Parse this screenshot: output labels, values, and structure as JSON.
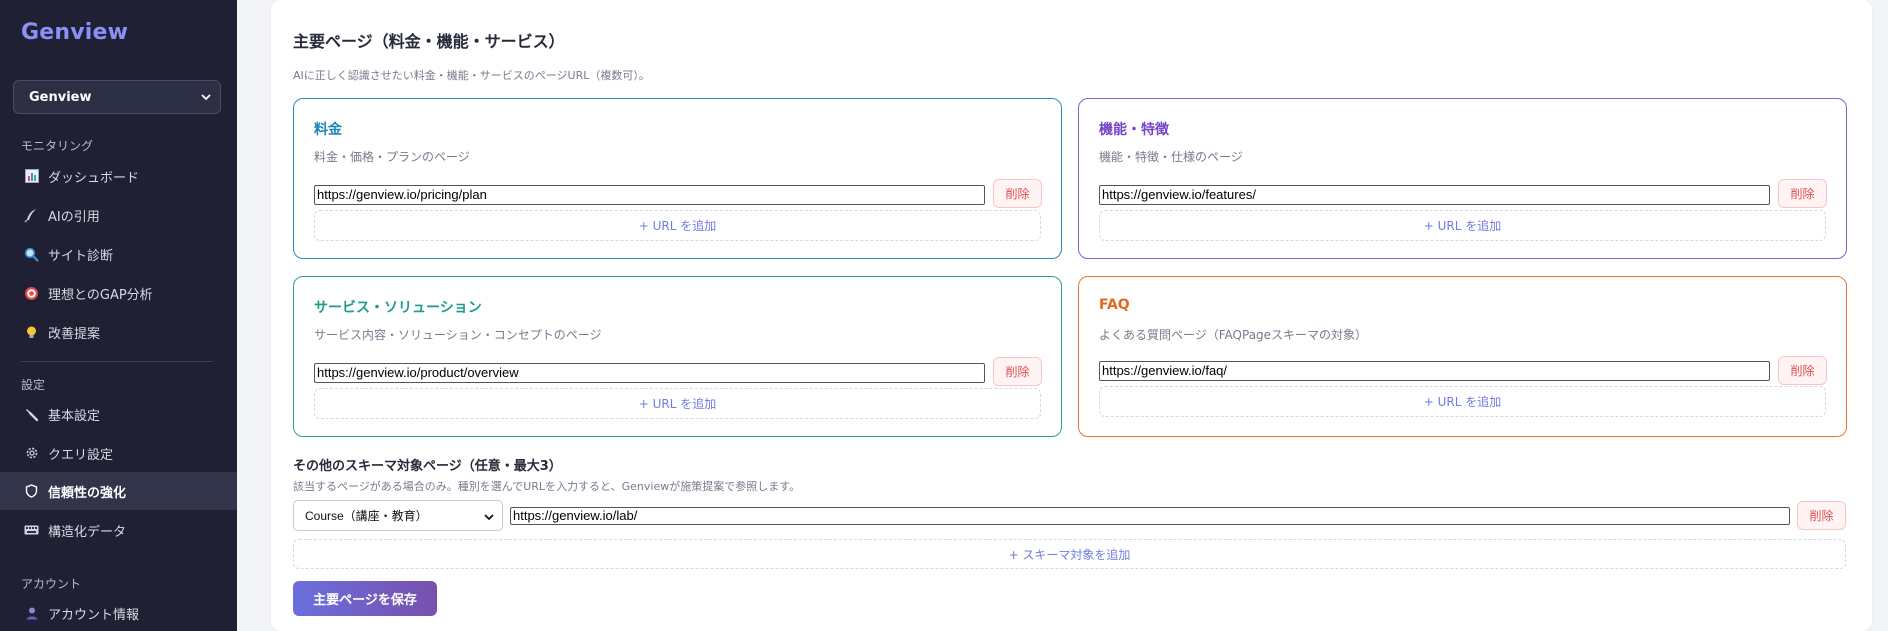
{
  "sidebar": {
    "brand": "Genview",
    "workspace": "Genview",
    "sections": {
      "monitoring": "モニタリング",
      "settings": "設定",
      "account": "アカウント"
    },
    "items": [
      {
        "label": "ダッシュボード",
        "icon": "bar-chart-icon"
      },
      {
        "label": "AIの引用",
        "icon": "quill-icon"
      },
      {
        "label": "サイト診断",
        "icon": "magnifier-icon"
      },
      {
        "label": "理想とのGAP分析",
        "icon": "target-icon"
      },
      {
        "label": "改善提案",
        "icon": "lightbulb-icon"
      },
      {
        "label": "基本設定",
        "icon": "wrench-icon"
      },
      {
        "label": "クエリ設定",
        "icon": "gear-icon"
      },
      {
        "label": "信頼性の強化",
        "icon": "shield-icon"
      },
      {
        "label": "構造化データ",
        "icon": "keyboard-icon"
      },
      {
        "label": "アカウント情報",
        "icon": "person-icon"
      }
    ]
  },
  "main": {
    "title": "主要ページ（料金・機能・サービス）",
    "description": "AIに正しく認識させたい料金・機能・サービスのページURL（複数可）。",
    "cards": [
      {
        "title": "料金",
        "desc": "料金・価格・プランのページ",
        "url": "https://genview.io/pricing/plan",
        "delete": "削除",
        "add": "+ URL を追加",
        "color": "#1e86b8"
      },
      {
        "title": "機能・特徴",
        "desc": "機能・特徴・仕様のページ",
        "url": "https://genview.io/features/",
        "delete": "削除",
        "add": "+ URL を追加",
        "color": "#7446c9"
      },
      {
        "title": "サービス・ソリューション",
        "desc": "サービス内容・ソリューション・コンセプトのページ",
        "url": "https://genview.io/product/overview",
        "delete": "削除",
        "add": "+ URL を追加",
        "color": "#1f9a8d"
      },
      {
        "title": "FAQ",
        "desc": "よくある質問ページ（FAQPageスキーマの対象）",
        "url": "https://genview.io/faq/",
        "delete": "削除",
        "add": "+ URL を追加",
        "color": "#e06a1d"
      }
    ],
    "other": {
      "title": "その他のスキーマ対象ページ（任意・最大3）",
      "desc": "該当するページがある場合のみ。種別を選んでURLを入力すると、Genviewが施策提案で参照します。",
      "type_selected": "Course（講座・教育）",
      "url": "https://genview.io/lab/",
      "delete": "削除",
      "add": "+ スキーマ対象を追加"
    },
    "save": "主要ページを保存"
  }
}
